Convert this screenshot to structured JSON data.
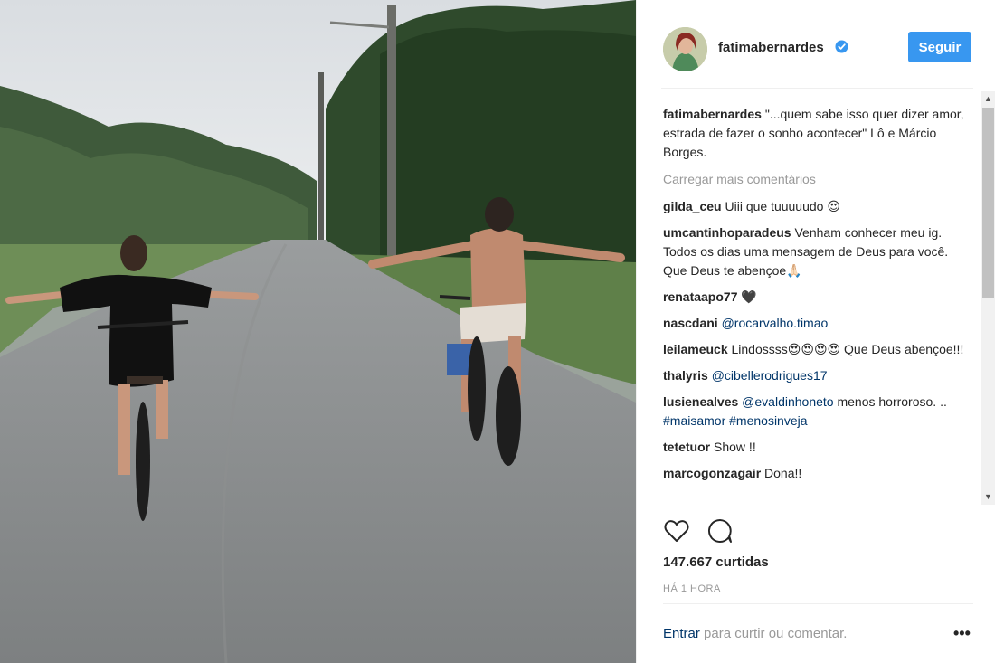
{
  "post": {
    "author": "fatimabernardes",
    "verified_icon": "verified-badge-icon",
    "follow_label": "Seguir",
    "caption_user": "fatimabernardes",
    "caption_text": "\"...quem sabe isso quer dizer amor, estrada de fazer o sonho acontecer\" Lô e Márcio Borges.",
    "load_more_label": "Carregar mais comentários",
    "likes_text": "147.667 curtidas",
    "time_text": "HÁ 1 HORA"
  },
  "comments": [
    {
      "user": "gilda_ceu",
      "parts": [
        {
          "text": "Uiii que tuuuuudo 😍",
          "link": false
        }
      ]
    },
    {
      "user": "umcantinhoparadeus",
      "parts": [
        {
          "text": "Venham conhecer meu ig. Todos os dias uma mensagem de Deus para você. Que Deus te abençoe🙏🏻",
          "link": false
        }
      ]
    },
    {
      "user": "renataapo77",
      "parts": [
        {
          "text": "🖤",
          "link": false
        }
      ]
    },
    {
      "user": "nascdani",
      "parts": [
        {
          "text": "@rocarvalho.timao",
          "link": true
        }
      ]
    },
    {
      "user": "leilameuck",
      "parts": [
        {
          "text": "Lindossss😍😍😍😍 Que Deus abençoe!!!",
          "link": false
        }
      ]
    },
    {
      "user": "thalyris",
      "parts": [
        {
          "text": "@cibellerodrigues17",
          "link": true
        }
      ]
    },
    {
      "user": "lusienealves",
      "parts": [
        {
          "text": "@evaldinhoneto",
          "link": true
        },
        {
          "text": " menos horroroso. .. ",
          "link": false
        },
        {
          "text": "#maisamor",
          "link": true
        },
        {
          "text": " ",
          "link": false
        },
        {
          "text": "#menosinveja",
          "link": true
        }
      ]
    },
    {
      "user": "tetetuor",
      "parts": [
        {
          "text": "Show !!",
          "link": false
        }
      ]
    },
    {
      "user": "marcogonzagair",
      "parts": [
        {
          "text": "Dona!!",
          "link": false
        }
      ]
    }
  ],
  "actions": {
    "like_icon": "heart-icon",
    "comment_icon": "comment-bubble-icon",
    "more_icon": "more-options-icon",
    "more_glyph": "•••"
  },
  "footer": {
    "login_link": "Entrar",
    "login_rest": " para curtir ou comentar."
  },
  "scrollbar": {
    "up": "▲",
    "down": "▼"
  },
  "colors": {
    "accent": "#3897f0",
    "link": "#003569",
    "muted": "#999999",
    "text": "#262626"
  }
}
